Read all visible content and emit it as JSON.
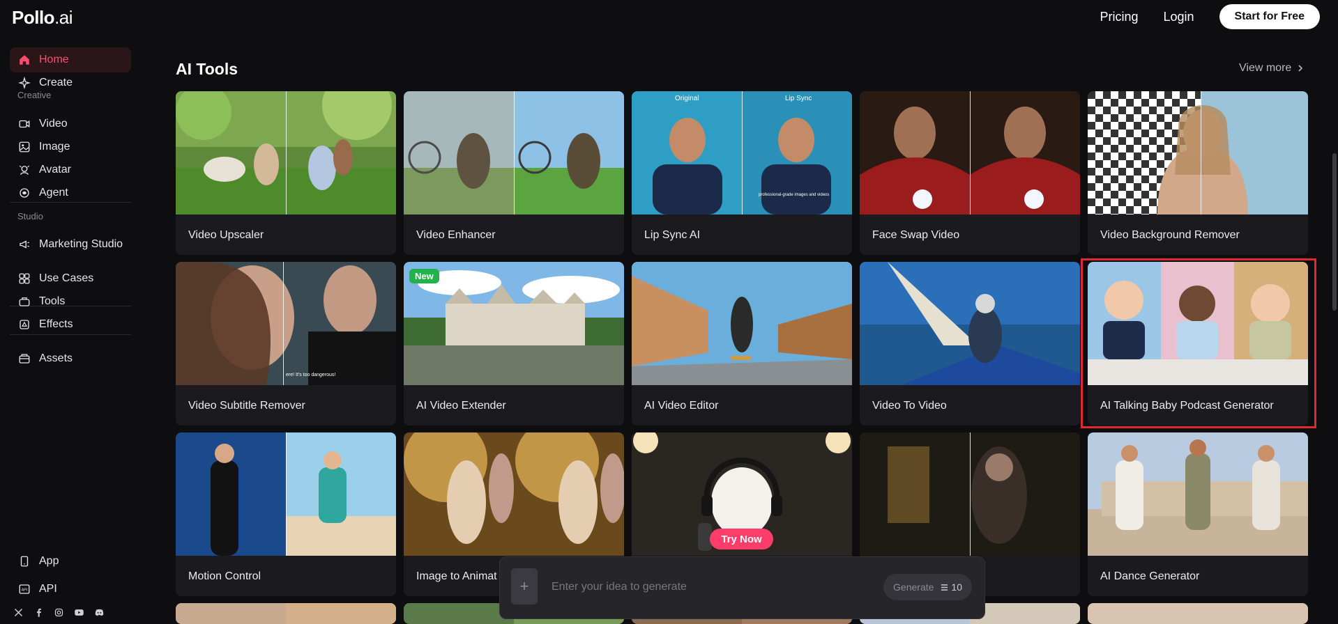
{
  "header": {
    "logo_main": "Pollo",
    "logo_suffix": ".ai",
    "pricing": "Pricing",
    "login": "Login",
    "start": "Start for Free"
  },
  "sidebar": {
    "items": [
      {
        "label": "Home",
        "icon": "home-icon",
        "active": true
      },
      {
        "label": "Create",
        "icon": "sparkle-icon"
      },
      {
        "label": "Video",
        "icon": "video-icon"
      },
      {
        "label": "Image",
        "icon": "image-icon"
      },
      {
        "label": "Avatar",
        "icon": "avatar-icon"
      },
      {
        "label": "Agent",
        "icon": "agent-icon"
      },
      {
        "label": "Marketing Studio",
        "icon": "megaphone-icon"
      },
      {
        "label": "Use Cases",
        "icon": "grid-icon"
      },
      {
        "label": "Tools",
        "icon": "tools-icon"
      },
      {
        "label": "Effects",
        "icon": "effects-icon"
      },
      {
        "label": "Assets",
        "icon": "assets-icon"
      },
      {
        "label": "App",
        "icon": "phone-icon"
      },
      {
        "label": "API",
        "icon": "api-icon"
      }
    ],
    "sections": {
      "creative": "Creative",
      "studio": "Studio"
    },
    "social": [
      "x-icon",
      "facebook-icon",
      "instagram-icon",
      "youtube-icon",
      "discord-icon"
    ]
  },
  "main": {
    "title": "AI Tools",
    "view_more": "View more",
    "cards": [
      {
        "label": "Video Upscaler"
      },
      {
        "label": "Video Enhancer"
      },
      {
        "label": "Lip Sync AI",
        "overlay_left": "Original",
        "overlay_right": "Lip Sync",
        "caption": "professional-grade images and videos"
      },
      {
        "label": "Face Swap Video"
      },
      {
        "label": "Video Background Remover"
      },
      {
        "label": "Video Subtitle Remover",
        "caption": "ere! It's too dangerous!"
      },
      {
        "label": "AI Video Extender",
        "badge": "New"
      },
      {
        "label": "AI Video Editor"
      },
      {
        "label": "Video To Video"
      },
      {
        "label": "AI Talking Baby Podcast Generator",
        "highlighted": true
      },
      {
        "label": "Motion Control"
      },
      {
        "label": "Image to Animat"
      },
      {
        "label": ""
      },
      {
        "label": ""
      },
      {
        "label": "AI Dance Generator"
      }
    ],
    "try_now": "Try Now"
  },
  "prompt": {
    "placeholder": "Enter your idea to generate",
    "generate": "Generate",
    "credits": "10"
  },
  "colors": {
    "background": "#0e0e11",
    "card": "#1b1b1f",
    "accent": "#ff3d6a",
    "highlight": "#e0282e",
    "new_badge": "#22b24c"
  }
}
